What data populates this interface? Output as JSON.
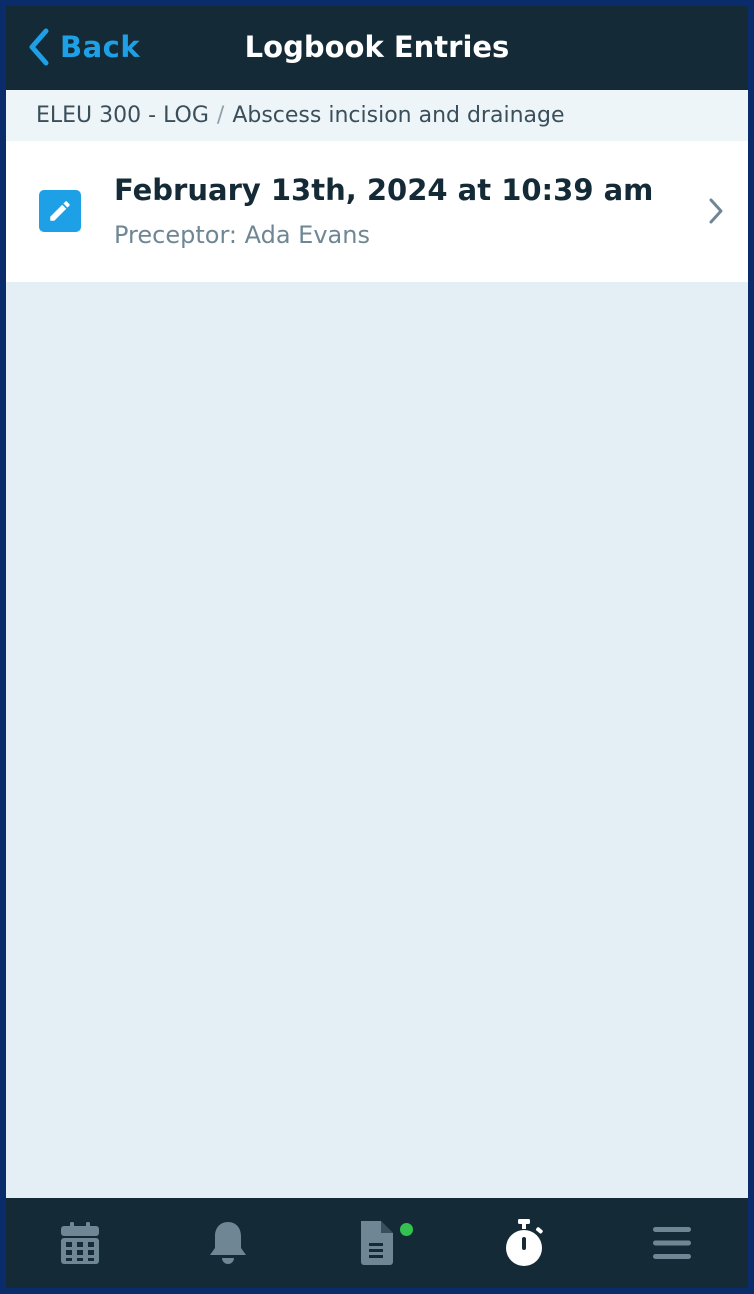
{
  "header": {
    "back_label": "Back",
    "title": "Logbook Entries"
  },
  "breadcrumb": {
    "course": "ELEU 300 - LOG",
    "separator": "/",
    "procedure": "Abscess incision and drainage"
  },
  "entries": [
    {
      "datetime": "February 13th, 2024 at 10:39 am",
      "preceptor": "Preceptor: Ada Evans",
      "icon": "edit-icon"
    }
  ],
  "tabbar": {
    "items": [
      {
        "icon": "calendar-icon",
        "active": false
      },
      {
        "icon": "bell-icon",
        "active": false
      },
      {
        "icon": "document-icon",
        "active": false,
        "badge": true
      },
      {
        "icon": "stopwatch-icon",
        "active": true
      },
      {
        "icon": "menu-icon",
        "active": false
      }
    ]
  },
  "colors": {
    "header_bg": "#142b37",
    "accent": "#1ea0e6",
    "content_bg": "#e3eef5",
    "badge_green": "#33c24f",
    "tab_icon_inactive": "#6f8794",
    "tab_icon_active": "#ffffff"
  }
}
